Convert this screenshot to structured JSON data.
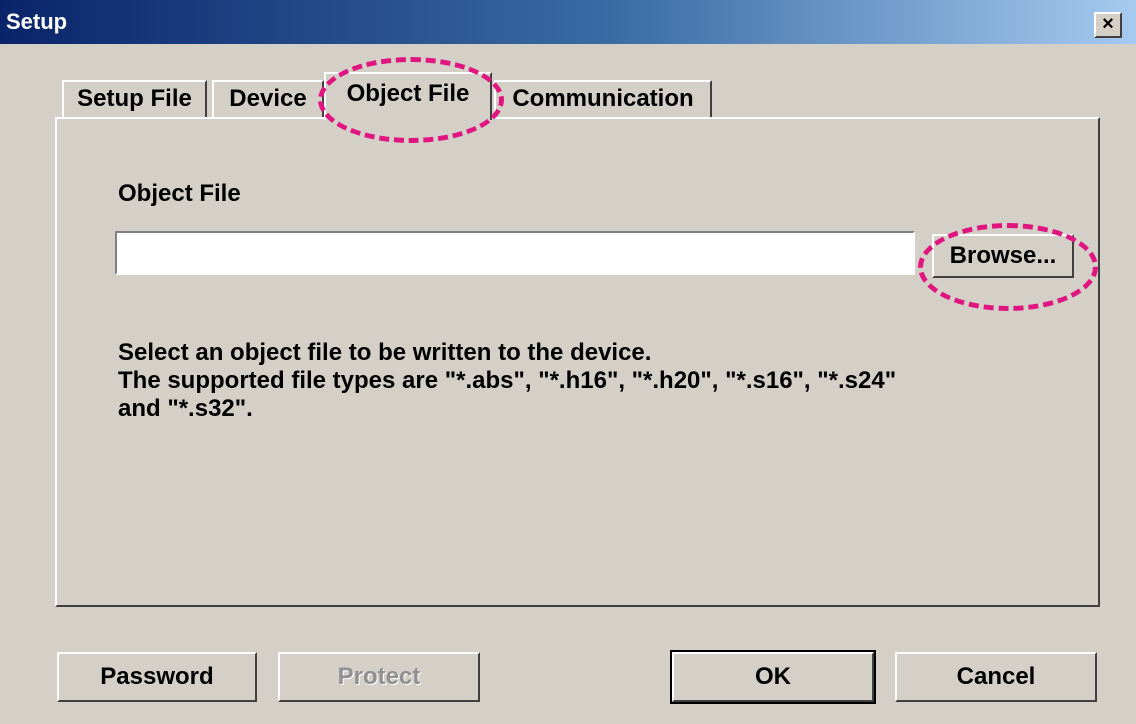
{
  "window": {
    "title": "Setup",
    "close_label": "×"
  },
  "tabs": [
    "Setup File",
    "Device",
    "Object File",
    "Communication"
  ],
  "active_tab": "Object File",
  "object_file": {
    "label": "Object File",
    "value": "",
    "browse_label": "Browse...",
    "description": [
      "Select an object file to be written to the device.",
      "The supported file types are \"*.abs\", \"*.h16\", \"*.h20\", \"*.s16\", \"*.s24\"",
      "and \"*.s32\"."
    ]
  },
  "buttons": {
    "password": "Password",
    "protect": "Protect",
    "ok": "OK",
    "cancel": "Cancel"
  },
  "colors": {
    "highlight": "#e0157f",
    "title_bar_start": "#0a246a",
    "title_bar_end": "#a6caf0",
    "dialog_bg": "#d4d0c8"
  }
}
